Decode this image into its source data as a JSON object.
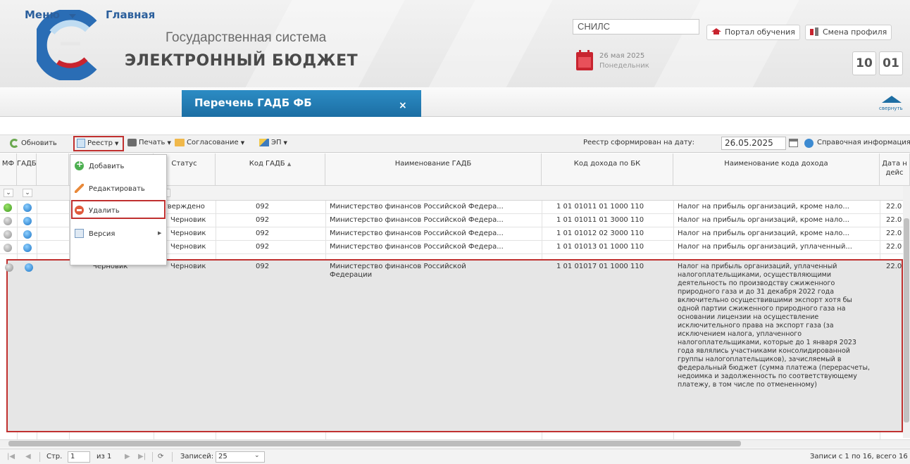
{
  "header": {
    "brand_top": "Государственная система",
    "brand_main": "ЭЛЕКТРОННЫЙ БЮДЖЕТ",
    "snils_label": "СНИЛС",
    "date": "26 мая 2025",
    "weekday": "Понедельник",
    "portal_button": "Портал обучения",
    "switch_profile_button": "Смена профиля",
    "clock_hours": "10",
    "clock_minutes": "01"
  },
  "nav": {
    "menu": "Меню",
    "home": "Главная",
    "active_tab": "Перечень ГАДБ ФБ",
    "close": "×",
    "collapse": "свернуть"
  },
  "toolbar": {
    "refresh": "Обновить",
    "registry": "Реестр",
    "print": "Печать",
    "approval": "Согласование",
    "signature": "ЭП",
    "registry_date_label": "Реестр сформирован на дату:",
    "registry_date": "26.05.2025",
    "info": "Справочная информация"
  },
  "registry_menu": {
    "items": [
      {
        "label": "Добавить",
        "icon": "add-icon"
      },
      {
        "label": "Редактировать",
        "icon": "edit-icon"
      },
      {
        "label": "Удалить",
        "icon": "delete-icon"
      },
      {
        "label": "Версия",
        "icon": "version-icon"
      }
    ]
  },
  "grid": {
    "columns": [
      "МФ",
      "ГАДБ",
      "",
      "Статус",
      "Код ГАДБ",
      "Наименование ГАДБ",
      "Код дохода по БК",
      "Наименование кода дохода",
      "Дата н дейс"
    ],
    "sort_indicator": "▲",
    "filter_caret": "⌄",
    "rows": [
      {
        "mf": "green",
        "gadb": "blue",
        "state": "",
        "status": "утверждено",
        "code": "092",
        "name": "Министерство финансов Российской Федера...",
        "kbk": "1 01 01011 01 1000 110",
        "kbk_name": "Налог на прибыль организаций, кроме нало...",
        "date": "22.0"
      },
      {
        "mf": "gray",
        "gadb": "blue",
        "state": "",
        "status": "Черновик",
        "code": "092",
        "name": "Министерство финансов Российской Федера...",
        "kbk": "1 01 01011 01 3000 110",
        "kbk_name": "Налог на прибыль организаций, кроме нало...",
        "date": "22.0"
      },
      {
        "mf": "gray",
        "gadb": "blue",
        "state": "",
        "status": "Черновик",
        "code": "092",
        "name": "Министерство финансов Российской Федера...",
        "kbk": "1 01 01012 02 3000 110",
        "kbk_name": "Налог на прибыль организаций, кроме нало...",
        "date": "22.0"
      },
      {
        "mf": "gray",
        "gadb": "blue",
        "state": "Черновик",
        "status": "Черновик",
        "code": "092",
        "name": "Министерство финансов Российской Федера...",
        "kbk": "1 01 01013 01 1000 110",
        "kbk_name": "Налог на прибыль организаций, уплаченный...",
        "date": "22.0"
      }
    ],
    "selected_row": {
      "mf": "gray",
      "gadb": "blue",
      "state": "Черновик",
      "status": "Черновик",
      "code": "092",
      "name": "Министерство финансов Российской Федерации",
      "kbk": "1 01 01017 01 1000 110",
      "kbk_name": "Налог на прибыль организаций, уплаченный налогоплательщиками, осуществляющими деятельность по производству сжиженного природного газа и до 31 декабря 2022 года включительно осуществившими экспорт хотя бы одной партии сжиженного природного газа на основании лицензии на осуществление исключительного права на экспорт газа (за исключением налога, уплаченного налогоплательщиками, которые до 1 января 2023 года являлись участниками консолидированной группы налогоплательщиков), зачисляемый в федеральный бюджет (сумма платежа (перерасчеты, недоимка и задолженность по соответствующему платежу, в том числе по отмененному)",
      "date": "22.0"
    }
  },
  "pager": {
    "page_label": "Стр.",
    "page": "1",
    "of": "из 1",
    "records_label": "Записей:",
    "records": "25",
    "summary": "Записи с 1 по 16, всего 16"
  }
}
